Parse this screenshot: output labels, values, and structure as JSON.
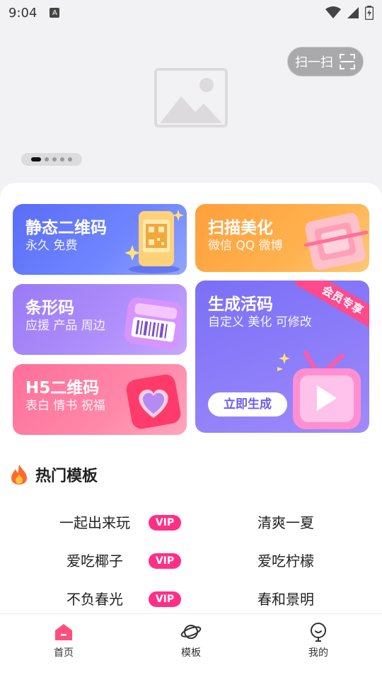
{
  "status": {
    "time": "9:04",
    "a_icon": "A"
  },
  "banner": {
    "image": "image-placeholder",
    "scan_label": "扫一扫",
    "dots": 5,
    "active_dot": 0
  },
  "cards": {
    "static_qr": {
      "title": "静态二维码",
      "subtitle": "永久 免费"
    },
    "scan_beautify": {
      "title": "扫描美化",
      "subtitle": "微信 QQ 微博"
    },
    "barcode": {
      "title": "条形码",
      "subtitle": "应援 产品 周边"
    },
    "h5_qr": {
      "title": "H5二维码",
      "subtitle": "表白 情书 祝福"
    },
    "live_code": {
      "title": "生成活码",
      "subtitle": "自定义 美化 可修改",
      "ribbon": "会员专享",
      "button": "立即生成"
    }
  },
  "section": {
    "title": "热门模板",
    "icon": "fire-icon"
  },
  "templates": {
    "left": [
      {
        "name": "一起出来玩",
        "badge": "VIP"
      },
      {
        "name": "爱吃椰子",
        "badge": "VIP"
      },
      {
        "name": "不负春光",
        "badge": "VIP"
      }
    ],
    "right": [
      {
        "name": "清爽一夏"
      },
      {
        "name": "爱吃柠檬"
      },
      {
        "name": "春和景明"
      }
    ]
  },
  "tabbar": {
    "items": [
      {
        "label": "首页",
        "icon": "home-icon",
        "active": true
      },
      {
        "label": "模板",
        "icon": "planet-icon",
        "active": false
      },
      {
        "label": "我的",
        "icon": "profile-icon",
        "active": false
      }
    ]
  },
  "colors": {
    "accent": "#ff4a8d",
    "vip": "#ff2f86",
    "static_card": "#6277f8",
    "scan_card": "#ffac47",
    "barcode_card": "#a785f8",
    "h5_card": "#ff7ea1",
    "live_card": "#8677f7"
  }
}
